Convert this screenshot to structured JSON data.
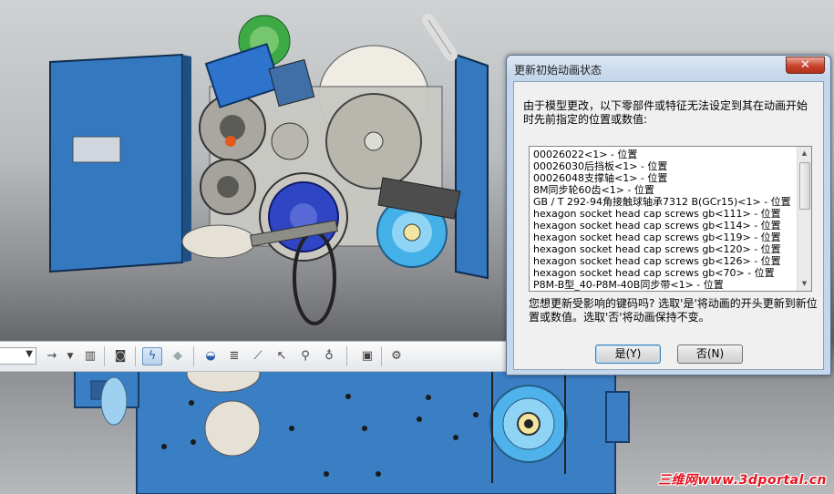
{
  "dialog": {
    "title": "更新初始动画状态",
    "close_label": "✕",
    "message": "由于模型更改，以下零部件或特征无法设定到其在动画开始时先前指定的位置或数值:",
    "items": [
      "00026022<1> - 位置",
      "00026030后挡板<1> - 位置",
      "00026048支撑轴<1> - 位置",
      "8M同步轮60齿<1> - 位置",
      "GB / T 292-94角接触球轴承7312 B(GCr15)<1> - 位置",
      "hexagon socket head cap screws gb<111> - 位置",
      "hexagon socket head cap screws gb<114> - 位置",
      "hexagon socket head cap screws gb<119> - 位置",
      "hexagon socket head cap screws gb<120> - 位置",
      "hexagon socket head cap screws gb<126> - 位置",
      "hexagon socket head cap screws gb<70> - 位置",
      "P8M-B型_40-P8M-40B同步带<1> - 位置"
    ],
    "question": "您想更新受影响的键码吗? 选取'是'将动画的开头更新到新位置或数值。选取'否'将动画保持不变。",
    "yes_label": "是(Y)",
    "no_label": "否(N)"
  },
  "toolbar": {
    "combo_value": "",
    "icons": [
      "dropdown-arrow-icon",
      "forward-arrow-icon",
      "dropdown-small-icon",
      "component-list-icon",
      "camera-icon",
      "motor-lightning-icon",
      "gravity-icon",
      "spring-icon",
      "contact-icon",
      "damper-icon",
      "cursor-arrow-icon",
      "force-icon",
      "mate-icon",
      "save-results-icon",
      "settings-gear-icon"
    ]
  },
  "watermark": "三维网www.3dportal.cn",
  "colors": {
    "panel_blue": "#3a7ec4",
    "dialog_frame": "#c5d7ea",
    "close_red": "#c7432c",
    "watermark_red": "#e8131f"
  }
}
